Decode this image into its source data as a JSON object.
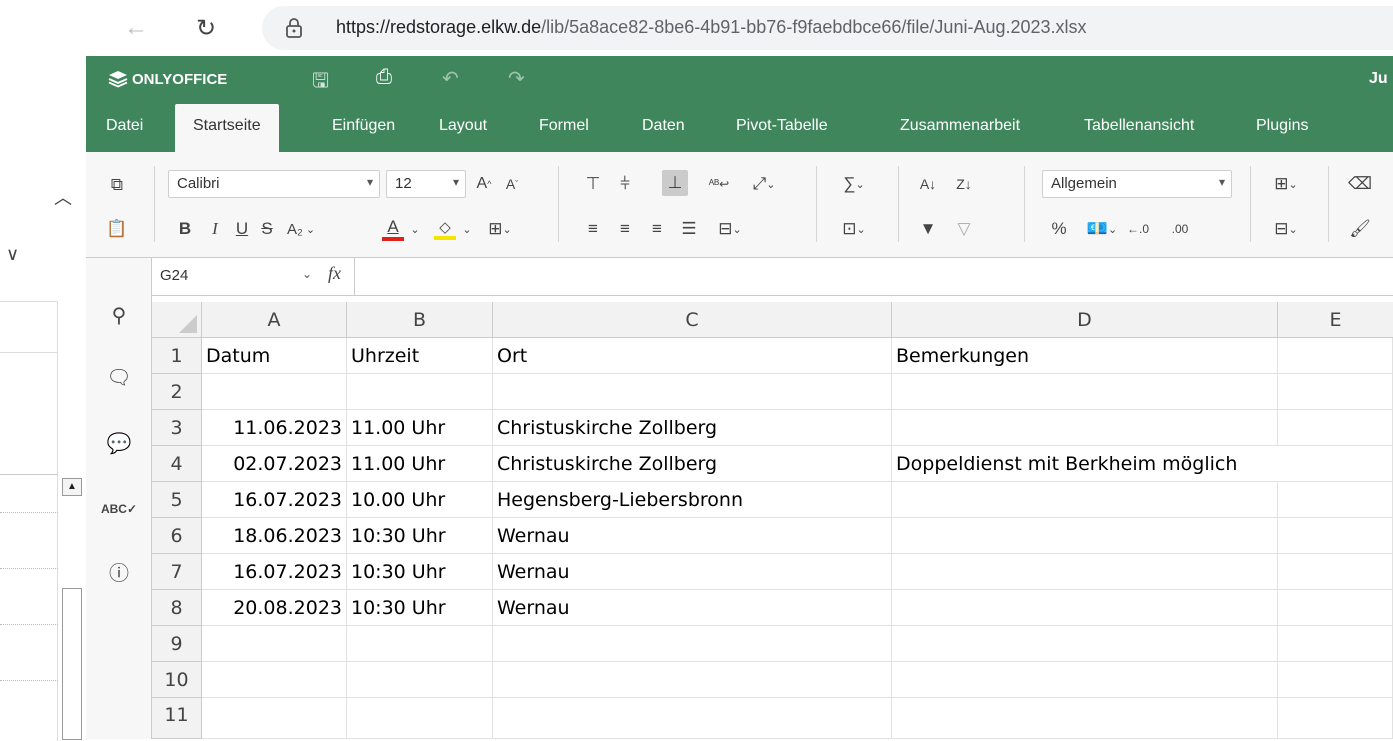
{
  "browser": {
    "url_host": "https://redstorage.elkw.de",
    "url_path": "/lib/5a8ace82-8be6-4b91-bb76-f9faebdbce66/file/Juni-Aug.2023.xlsx"
  },
  "app": {
    "logo_text": "ONLYOFFICE",
    "title_fragment": "Ju"
  },
  "menu_tabs": [
    "Datei",
    "Startseite",
    "Einfügen",
    "Layout",
    "Formel",
    "Daten",
    "Pivot-Tabelle",
    "Zusammenarbeit",
    "Tabellenansicht",
    "Plugins"
  ],
  "active_tab": "Startseite",
  "toolbar": {
    "font_name": "Calibri",
    "font_size": "12",
    "number_format": "Allgemein",
    "bold": "B",
    "italic": "I",
    "underline": "U",
    "strike": "S",
    "subscript": "A₂",
    "font_color": "A",
    "font_color_hex": "#e0201b",
    "fill_color_hex": "#f5e300",
    "percent": "%",
    "increase_font": "A",
    "decrease_font": "A"
  },
  "formula_bar": {
    "cell_name": "G24",
    "fx": "fx",
    "value": ""
  },
  "sheet": {
    "columns": [
      "A",
      "B",
      "C",
      "D",
      "E"
    ],
    "rows": [
      {
        "num": "1",
        "A": "Datum",
        "B": "Uhrzeit",
        "C": "Ort",
        "D": "Bemerkungen"
      },
      {
        "num": "2",
        "A": "",
        "B": "",
        "C": "",
        "D": ""
      },
      {
        "num": "3",
        "A": "11.06.2023",
        "B": "11.00 Uhr",
        "C": "Christuskirche Zollberg",
        "D": ""
      },
      {
        "num": "4",
        "A": "02.07.2023",
        "B": "11.00 Uhr",
        "C": "Christuskirche Zollberg",
        "D": "Doppeldienst mit Berkheim möglich"
      },
      {
        "num": "5",
        "A": "16.07.2023",
        "B": "10.00 Uhr",
        "C": "Hegensberg-Liebersbronn",
        "D": ""
      },
      {
        "num": "6",
        "A": "18.06.2023",
        "B": "10:30 Uhr",
        "C": "Wernau",
        "D": ""
      },
      {
        "num": "7",
        "A": "16.07.2023",
        "B": "10:30 Uhr",
        "C": "Wernau",
        "D": ""
      },
      {
        "num": "8",
        "A": "20.08.2023",
        "B": "10:30 Uhr",
        "C": "Wernau",
        "D": ""
      },
      {
        "num": "9",
        "A": "",
        "B": "",
        "C": "",
        "D": ""
      },
      {
        "num": "10",
        "A": "",
        "B": "",
        "C": "",
        "D": ""
      },
      {
        "num": "11",
        "A": "",
        "B": "",
        "C": "",
        "D": ""
      }
    ]
  },
  "colors": {
    "header_green": "#40865c",
    "toolbar_bg": "#f7f7f7"
  }
}
